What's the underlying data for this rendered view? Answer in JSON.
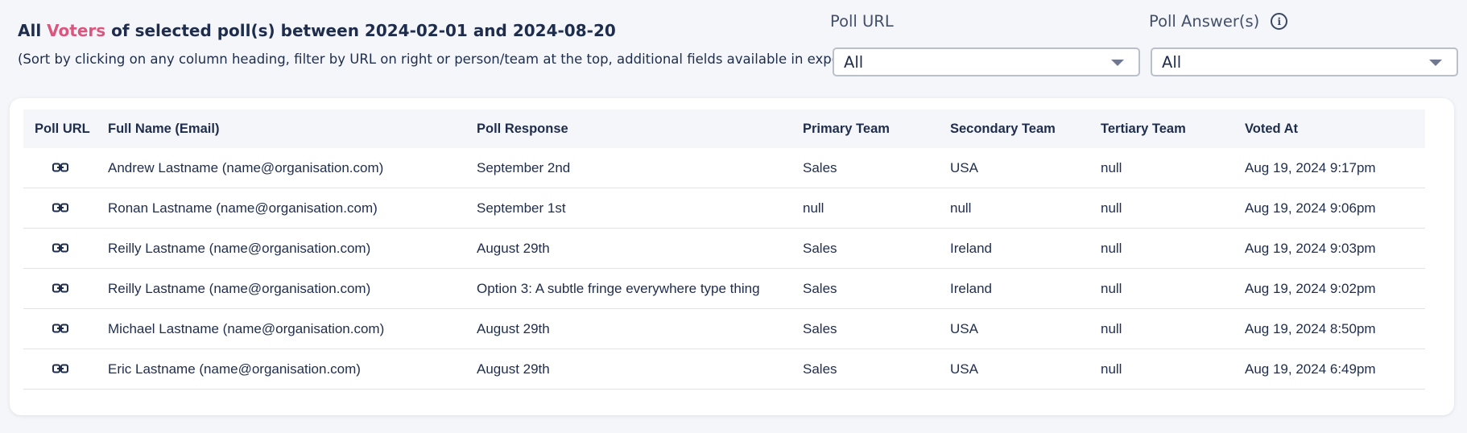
{
  "header": {
    "title_prefix": "All",
    "title_accent": "Voters",
    "title_middle": "of selected poll(s) between",
    "start_date": "2024-02-01",
    "title_and": "and",
    "end_date": "2024-08-20",
    "subtitle": "(Sort by clicking on any column heading, filter by URL on right or person/team at the top, additional fields available in export)"
  },
  "filters": {
    "poll_url": {
      "label": "Poll URL",
      "value": "All",
      "icon": "chevron-down-icon"
    },
    "poll_answers": {
      "label": "Poll Answer(s)",
      "value": "All",
      "info_icon": "info-icon",
      "icon": "chevron-down-icon"
    }
  },
  "table": {
    "columns": [
      "Poll URL",
      "Full Name (Email)",
      "Poll Response",
      "Primary Team",
      "Secondary Team",
      "Tertiary Team",
      "Voted At"
    ],
    "rows": [
      {
        "icon": "link-icon",
        "name": "Andrew Lastname (name@organisation.com)",
        "response": "September 2nd",
        "primary": "Sales",
        "secondary": "USA",
        "tertiary": "null",
        "voted_at": "Aug 19, 2024 9:17pm"
      },
      {
        "icon": "link-icon",
        "name": "Ronan Lastname (name@organisation.com)",
        "response": "September 1st",
        "primary": "null",
        "secondary": "null",
        "tertiary": "null",
        "voted_at": "Aug 19, 2024 9:06pm"
      },
      {
        "icon": "link-icon",
        "name": "Reilly Lastname (name@organisation.com)",
        "response": "August 29th",
        "primary": "Sales",
        "secondary": "Ireland",
        "tertiary": "null",
        "voted_at": "Aug 19, 2024 9:03pm"
      },
      {
        "icon": "link-icon",
        "name": "Reilly Lastname (name@organisation.com)",
        "response": "Option 3: A subtle fringe everywhere type thing",
        "primary": "Sales",
        "secondary": "Ireland",
        "tertiary": "null",
        "voted_at": "Aug 19, 2024 9:02pm"
      },
      {
        "icon": "link-icon",
        "name": "Michael Lastname (name@organisation.com)",
        "response": "August 29th",
        "primary": "Sales",
        "secondary": "USA",
        "tertiary": "null",
        "voted_at": "Aug 19, 2024 8:50pm"
      },
      {
        "icon": "link-icon",
        "name": "Eric Lastname (name@organisation.com)",
        "response": "August 29th",
        "primary": "Sales",
        "secondary": "USA",
        "tertiary": "null",
        "voted_at": "Aug 19, 2024 6:49pm"
      }
    ]
  },
  "colors": {
    "accent": "#d9577e",
    "text": "#1f2d4d",
    "background": "#f4f6f9",
    "card": "#ffffff"
  }
}
